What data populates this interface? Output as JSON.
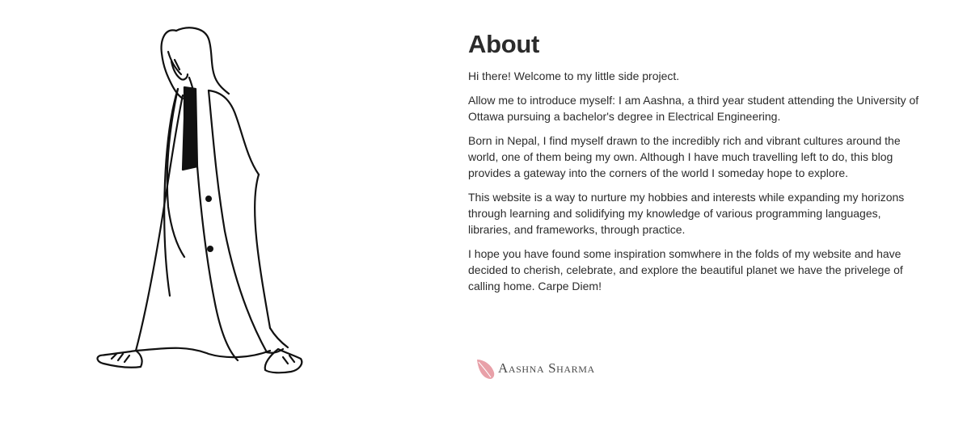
{
  "about": {
    "title": "About",
    "paragraphs": [
      "Hi there! Welcome to my little side project.",
      "Allow me to introduce myself: I am Aashna, a third year student attending the University of Ottawa pursuing a bachelor's degree in Electrical Engineering.",
      "Born in Nepal, I find myself drawn to the incredibly rich and vibrant cultures around the world, one of them being my own. Although I have much travelling left to do, this blog provides a gateway into the corners of the world I someday hope to explore.",
      "This website is a way to nurture my hobbies and interests while expanding my horizons through learning and solidifying my knowledge of various programming languages, libraries, and frameworks, through practice.",
      "I hope you have found some inspiration somwhere in the folds of my website and have decided to cherish, celebrate, and explore the beautiful planet we have the privelege of calling home. Carpe Diem!"
    ]
  },
  "signature": {
    "name": "Aashna Sharma",
    "icon": "leaf-icon",
    "leaf_color": "#e8a0a8"
  },
  "illustration": {
    "icon": "walking-woman-illustration"
  }
}
